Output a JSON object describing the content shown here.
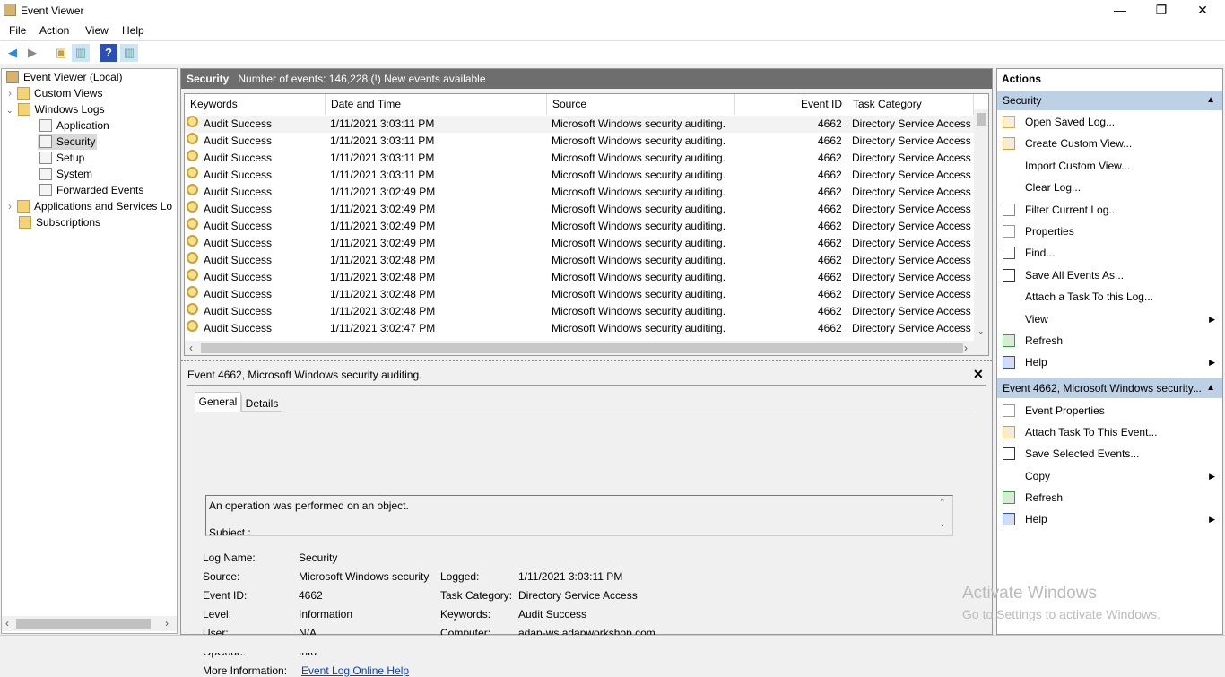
{
  "window": {
    "title": "Event Viewer",
    "minimize": "—",
    "restore": "❐",
    "close": "✕"
  },
  "menu": [
    "File",
    "Action",
    "View",
    "Help"
  ],
  "tree": [
    {
      "label": "Event Viewer (Local)"
    },
    {
      "label": "Custom Views"
    },
    {
      "label": "Windows Logs"
    },
    {
      "label": "Application"
    },
    {
      "label": "Security"
    },
    {
      "label": "Setup"
    },
    {
      "label": "System"
    },
    {
      "label": "Forwarded Events"
    },
    {
      "label": "Applications and Services Lo"
    },
    {
      "label": "Subscriptions"
    }
  ],
  "log": {
    "name": "Security",
    "summary": "Number of events: 146,228 (!) New events available"
  },
  "columns": [
    "Keywords",
    "Date and Time",
    "Source",
    "Event ID",
    "Task Category"
  ],
  "events": [
    {
      "k": "Audit Success",
      "d": "1/11/2021 3:03:11 PM",
      "s": "Microsoft Windows security auditing.",
      "id": "4662",
      "c": "Directory Service Access"
    },
    {
      "k": "Audit Success",
      "d": "1/11/2021 3:03:11 PM",
      "s": "Microsoft Windows security auditing.",
      "id": "4662",
      "c": "Directory Service Access"
    },
    {
      "k": "Audit Success",
      "d": "1/11/2021 3:03:11 PM",
      "s": "Microsoft Windows security auditing.",
      "id": "4662",
      "c": "Directory Service Access"
    },
    {
      "k": "Audit Success",
      "d": "1/11/2021 3:03:11 PM",
      "s": "Microsoft Windows security auditing.",
      "id": "4662",
      "c": "Directory Service Access"
    },
    {
      "k": "Audit Success",
      "d": "1/11/2021 3:02:49 PM",
      "s": "Microsoft Windows security auditing.",
      "id": "4662",
      "c": "Directory Service Access"
    },
    {
      "k": "Audit Success",
      "d": "1/11/2021 3:02:49 PM",
      "s": "Microsoft Windows security auditing.",
      "id": "4662",
      "c": "Directory Service Access"
    },
    {
      "k": "Audit Success",
      "d": "1/11/2021 3:02:49 PM",
      "s": "Microsoft Windows security auditing.",
      "id": "4662",
      "c": "Directory Service Access"
    },
    {
      "k": "Audit Success",
      "d": "1/11/2021 3:02:49 PM",
      "s": "Microsoft Windows security auditing.",
      "id": "4662",
      "c": "Directory Service Access"
    },
    {
      "k": "Audit Success",
      "d": "1/11/2021 3:02:48 PM",
      "s": "Microsoft Windows security auditing.",
      "id": "4662",
      "c": "Directory Service Access"
    },
    {
      "k": "Audit Success",
      "d": "1/11/2021 3:02:48 PM",
      "s": "Microsoft Windows security auditing.",
      "id": "4662",
      "c": "Directory Service Access"
    },
    {
      "k": "Audit Success",
      "d": "1/11/2021 3:02:48 PM",
      "s": "Microsoft Windows security auditing.",
      "id": "4662",
      "c": "Directory Service Access"
    },
    {
      "k": "Audit Success",
      "d": "1/11/2021 3:02:48 PM",
      "s": "Microsoft Windows security auditing.",
      "id": "4662",
      "c": "Directory Service Access"
    },
    {
      "k": "Audit Success",
      "d": "1/11/2021 3:02:47 PM",
      "s": "Microsoft Windows security auditing.",
      "id": "4662",
      "c": "Directory Service Access"
    }
  ],
  "detail": {
    "title": "Event 4662, Microsoft Windows security auditing.",
    "tabs": [
      "General",
      "Details"
    ],
    "message": "An operation was performed on an object.",
    "message2": "Subiect :",
    "fields": [
      {
        "l": "Log Name:",
        "v": "Security"
      },
      {
        "l": "Source:",
        "v": "Microsoft Windows security"
      },
      {
        "l": "Event ID:",
        "v": "4662"
      },
      {
        "l": "Level:",
        "v": "Information"
      },
      {
        "l": "User:",
        "v": "N/A"
      },
      {
        "l": "OpCode:",
        "v": "Info"
      },
      {
        "l": "More Information:",
        "v": "Event Log Online Help"
      }
    ],
    "fields2": [
      {
        "l": "Logged:",
        "v": "1/11/2021 3:03:11 PM"
      },
      {
        "l": "Task Category:",
        "v": "Directory Service Access"
      },
      {
        "l": "Keywords:",
        "v": "Audit Success"
      },
      {
        "l": "Computer:",
        "v": "adap-ws.adapworkshop.com"
      }
    ]
  },
  "actions": {
    "title": "Actions",
    "section1": "Security",
    "items1": [
      "Open Saved Log...",
      "Create Custom View...",
      "Import Custom View...",
      "Clear Log...",
      "Filter Current Log...",
      "Properties",
      "Find...",
      "Save All Events As...",
      "Attach a Task To this Log...",
      "View",
      "Refresh",
      "Help"
    ],
    "section2": "Event 4662, Microsoft Windows security...",
    "items2": [
      "Event Properties",
      "Attach Task To This Event...",
      "Save Selected Events...",
      "Copy",
      "Refresh",
      "Help"
    ]
  },
  "watermark": {
    "line1": "Activate Windows",
    "line2": "Go to Settings to activate Windows."
  }
}
